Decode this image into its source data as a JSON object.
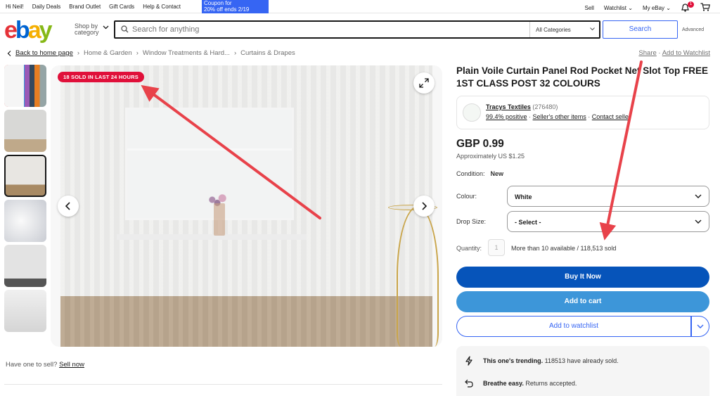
{
  "topbar": {
    "greeting": "Hi Neil!",
    "links": [
      "Daily Deals",
      "Brand Outlet",
      "Gift Cards",
      "Help & Contact"
    ],
    "coupon_line1": "Coupon for",
    "coupon_line2": "20% off ends 2/19",
    "sell": "Sell",
    "watchlist": "Watchlist",
    "myebay": "My eBay",
    "notification_count": "1"
  },
  "header": {
    "logo": [
      "e",
      "b",
      "a",
      "y"
    ],
    "shop_by_line1": "Shop by",
    "shop_by_line2": "category",
    "search_placeholder": "Search for anything",
    "category": "All Categories",
    "search_button": "Search",
    "advanced": "Advanced"
  },
  "breadcrumb": {
    "back": "Back to home page",
    "items": [
      "Home & Garden",
      "Window Treatments & Hard...",
      "Curtains & Drapes"
    ],
    "share": "Share",
    "add_watchlist": "Add to Watchlist"
  },
  "gallery": {
    "badge": "18 SOLD IN LAST 24 HOURS",
    "sell_prompt": "Have one to sell?",
    "sell_link": "Sell now"
  },
  "product": {
    "title": "Plain Voile Curtain Panel Rod Pocket Net Slot Top FREE 1ST CLASS POST 32 COLOURS",
    "seller_name": "Tracys Textiles",
    "seller_count": "(276480)",
    "seller_positive": "99.4% positive",
    "seller_other": "Seller's other items",
    "contact": "Contact seller",
    "price": "GBP 0.99",
    "approx": "Approximately US $1.25",
    "condition_label": "Condition:",
    "condition_value": "New",
    "colour_label": "Colour:",
    "colour_value": "White",
    "drop_label": "Drop Size:",
    "drop_value": "- Select -",
    "quantity_label": "Quantity:",
    "quantity_value": "1",
    "availability": "More than 10 available / 118,513 sold",
    "buy_now": "Buy It Now",
    "add_cart": "Add to cart",
    "add_watchlist": "Add to watchlist",
    "trending_bold": "This one's trending.",
    "trending_text": "118513 have already sold.",
    "breathe_bold": "Breathe easy.",
    "breathe_text": "Returns accepted."
  },
  "colors": {
    "arrow": "#e8424a",
    "badge": "#e0103a",
    "buy": "#0654ba",
    "cart": "#3d96d9",
    "link_blue": "#3665f3"
  }
}
